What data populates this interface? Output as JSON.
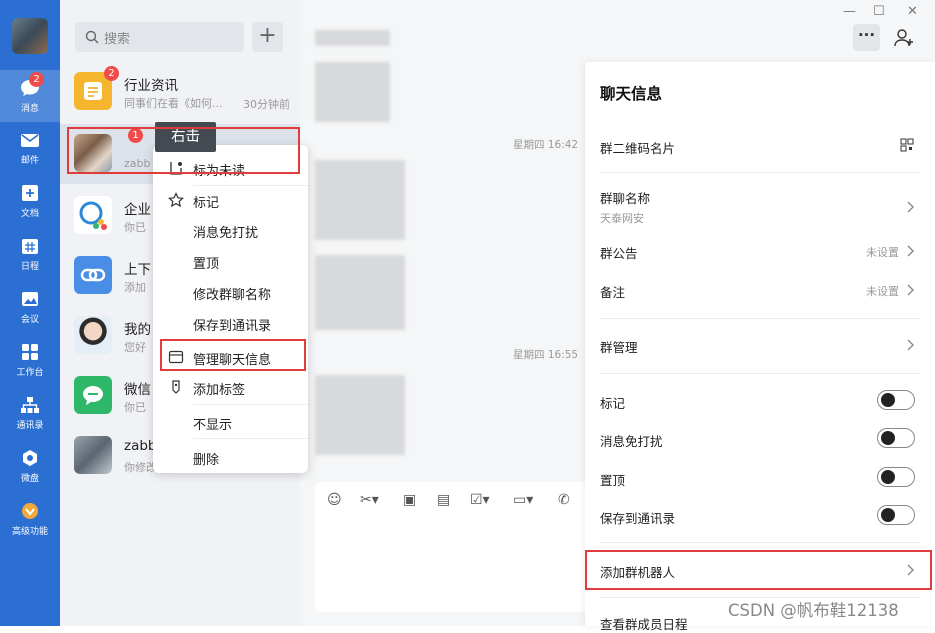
{
  "rail": {
    "items": [
      {
        "label": "消息",
        "badge": "2"
      },
      {
        "label": "邮件"
      },
      {
        "label": "文档"
      },
      {
        "label": "日程"
      },
      {
        "label": "会议"
      },
      {
        "label": "工作台"
      },
      {
        "label": "通讯录"
      },
      {
        "label": "微盘"
      },
      {
        "label": "高级功能"
      }
    ]
  },
  "list": {
    "search_placeholder": "搜索",
    "add_label": "+",
    "conversations": [
      {
        "name": "行业资讯",
        "preview": "同事们在看《如何...",
        "time": "30分钟前",
        "badge": "2"
      },
      {
        "name": "",
        "preview": "zabb",
        "badge": "1"
      },
      {
        "name": "企业",
        "preview": "你已"
      },
      {
        "name": "上下",
        "preview": "添加"
      },
      {
        "name": "我的",
        "preview": "您好"
      },
      {
        "name": "微信",
        "preview": "你已"
      },
      {
        "name": "zabb",
        "preview": "你修改"
      }
    ]
  },
  "tooltip": "右击",
  "context_menu": {
    "items": [
      "标为未读",
      "标记",
      "消息免打扰",
      "置顶",
      "修改群聊名称",
      "保存到通讯录",
      "管理聊天信息",
      "添加标签",
      "不显示",
      "删除"
    ]
  },
  "chat": {
    "timestamps": [
      "星期四 16:42",
      "星期四 16:55"
    ]
  },
  "window": {
    "more": "···",
    "minimize": "—",
    "maximize": "☐",
    "close": "✕"
  },
  "panel": {
    "title": "聊天信息",
    "qr_label": "群二维码名片",
    "group_name_label": "群聊名称",
    "group_name_value": "天泰网安",
    "announcement_label": "群公告",
    "announcement_value": "未设置",
    "note_label": "备注",
    "note_value": "未设置",
    "manage_label": "群管理",
    "toggles": [
      "标记",
      "消息免打扰",
      "置顶",
      "保存到通讯录"
    ],
    "robot_label": "添加群机器人",
    "schedule_label": "查看群成员日程"
  },
  "watermark": "CSDN @帆布鞋12138"
}
